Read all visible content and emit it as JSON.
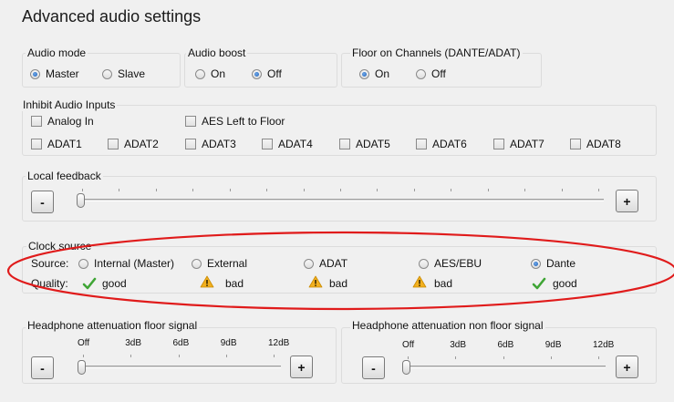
{
  "title": "Advanced audio settings",
  "audio_mode": {
    "label": "Audio mode",
    "options": [
      "Master",
      "Slave"
    ],
    "selected": "Master"
  },
  "audio_boost": {
    "label": "Audio boost",
    "options": [
      "On",
      "Off"
    ],
    "selected": "Off"
  },
  "floor_channels": {
    "label": "Floor on Channels (DANTE/ADAT)",
    "options": [
      "On",
      "Off"
    ],
    "selected": "On"
  },
  "inhibit": {
    "label": "Inhibit Audio Inputs",
    "analog_in": "Analog In",
    "aes_left": "AES Left to Floor",
    "adat": [
      "ADAT1",
      "ADAT2",
      "ADAT3",
      "ADAT4",
      "ADAT5",
      "ADAT6",
      "ADAT7",
      "ADAT8"
    ]
  },
  "local_feedback": {
    "label": "Local feedback",
    "minus": "-",
    "plus": "+",
    "level": 0
  },
  "clock": {
    "label": "Clock source",
    "source_label": "Source:",
    "quality_label": "Quality:",
    "sources": [
      "Internal (Master)",
      "External",
      "ADAT",
      "AES/EBU",
      "Dante"
    ],
    "selected": "Dante",
    "qualities": [
      "good",
      "bad",
      "bad",
      "bad",
      "good"
    ],
    "good_color": "#3fa535",
    "bad_color": "#f2b01e",
    "highlight_color": "#e01b1b"
  },
  "hp_floor": {
    "label": "Headphone attenuation floor signal",
    "scale": [
      "Off",
      "3dB",
      "6dB",
      "9dB",
      "12dB"
    ],
    "minus": "-",
    "plus": "+",
    "level": 0
  },
  "hp_nonfloor": {
    "label": "Headphone attenuation non floor signal",
    "scale": [
      "Off",
      "3dB",
      "6dB",
      "9dB",
      "12dB"
    ],
    "minus": "-",
    "plus": "+",
    "level": 0
  }
}
